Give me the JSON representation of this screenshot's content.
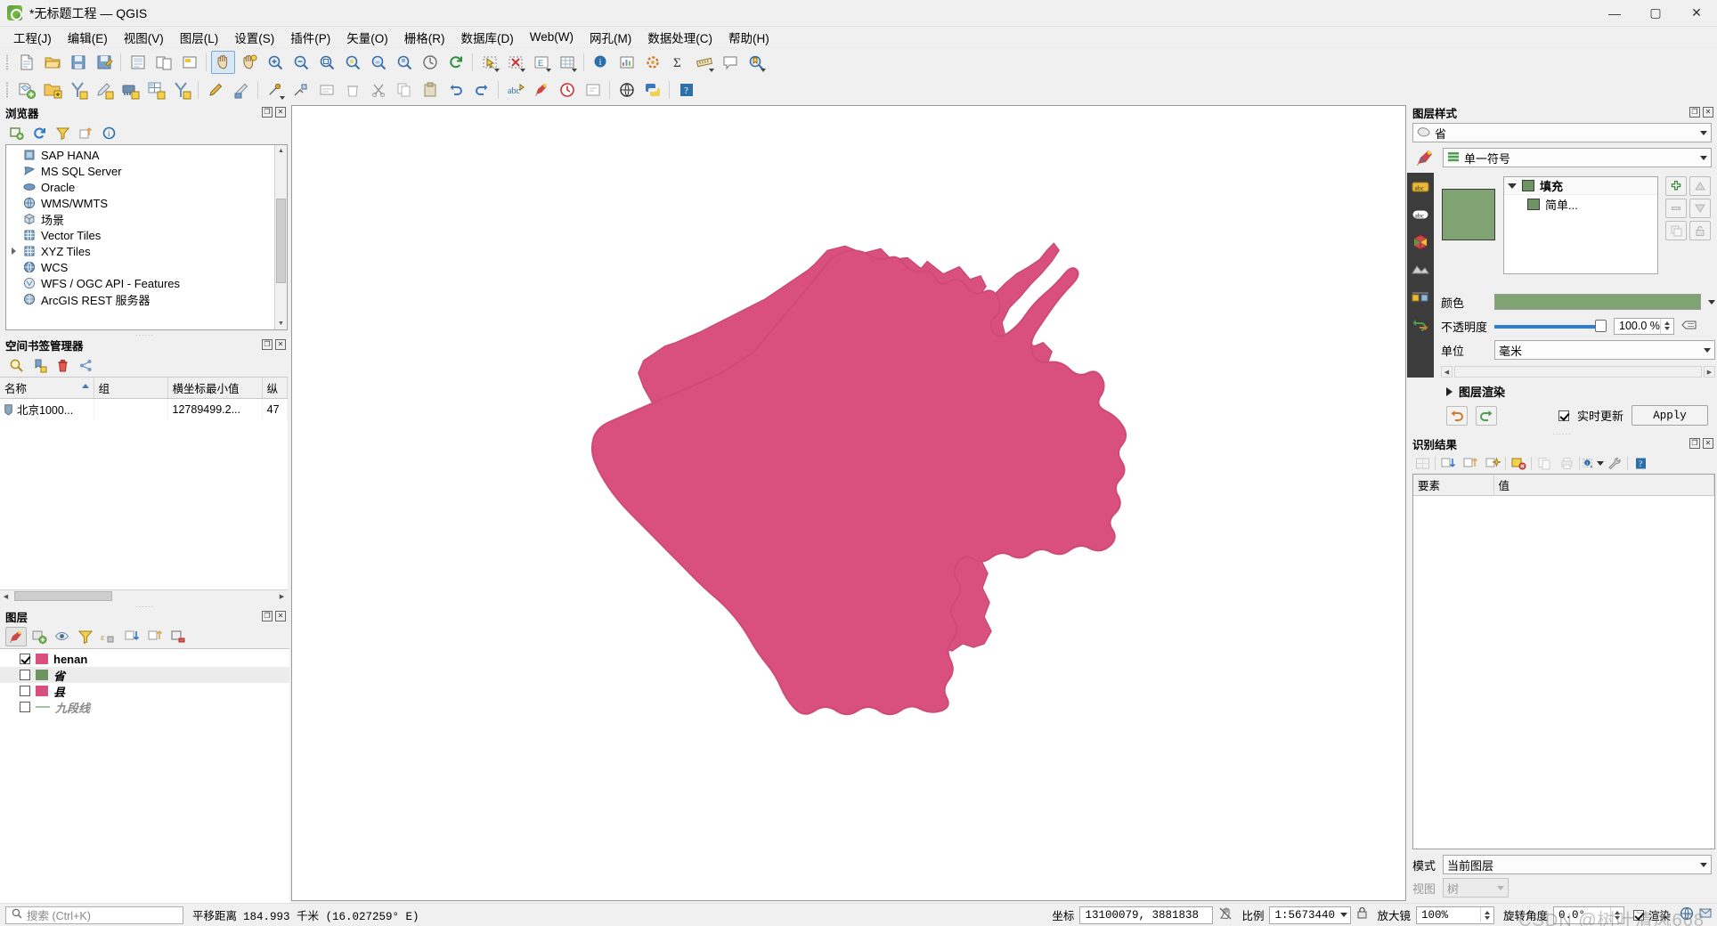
{
  "window": {
    "title": "*无标题工程 — QGIS",
    "app_icon": "qgis-logo-icon",
    "minimize": "—",
    "maximize": "▢",
    "close": "✕"
  },
  "menubar": {
    "items": [
      {
        "label": "工程(J)"
      },
      {
        "label": "编辑(E)"
      },
      {
        "label": "视图(V)"
      },
      {
        "label": "图层(L)"
      },
      {
        "label": "设置(S)"
      },
      {
        "label": "插件(P)"
      },
      {
        "label": "矢量(O)"
      },
      {
        "label": "栅格(R)"
      },
      {
        "label": "数据库(D)"
      },
      {
        "label": "Web(W)"
      },
      {
        "label": "网孔(M)"
      },
      {
        "label": "数据处理(C)"
      },
      {
        "label": "帮助(H)"
      }
    ]
  },
  "browser_panel": {
    "title": "浏览器",
    "tools": [
      "add-layer-icon",
      "refresh-icon",
      "filter-icon",
      "collapse-all-icon",
      "properties-info-icon"
    ],
    "items": [
      {
        "label": "SAP HANA",
        "icon": "sap-hana-icon",
        "expandable": false
      },
      {
        "label": "MS SQL Server",
        "icon": "mssql-icon",
        "expandable": false
      },
      {
        "label": "Oracle",
        "icon": "oracle-icon",
        "expandable": false
      },
      {
        "label": "WMS/WMTS",
        "icon": "wms-globe-icon",
        "expandable": false
      },
      {
        "label": "场景",
        "icon": "scene-cube-icon",
        "expandable": false
      },
      {
        "label": "Vector Tiles",
        "icon": "vector-tiles-icon",
        "expandable": false
      },
      {
        "label": "XYZ Tiles",
        "icon": "xyz-tiles-icon",
        "expandable": true
      },
      {
        "label": "WCS",
        "icon": "wcs-globe-icon",
        "expandable": false
      },
      {
        "label": "WFS / OGC API - Features",
        "icon": "wfs-icon",
        "expandable": false
      },
      {
        "label": "ArcGIS REST 服务器",
        "icon": "arcgis-rest-icon",
        "expandable": false
      }
    ]
  },
  "bookmarks_panel": {
    "title": "空间书签管理器",
    "tools": [
      "zoom-to-bookmark-icon",
      "add-bookmark-icon",
      "delete-bookmark-icon",
      "share-bookmark-icon"
    ],
    "columns": [
      "名称",
      "组",
      "横坐标最小值",
      "纵"
    ],
    "rows": [
      {
        "name": "北京1000...",
        "group": "",
        "xmin": "12789499.2...",
        "ymin": "47"
      }
    ]
  },
  "layers_panel": {
    "title": "图层",
    "tools": [
      "open-layer-styling-icon",
      "add-group-icon",
      "manage-visibility-icon",
      "filter-legend-icon",
      "expression-filter-icon",
      "expand-all-icon",
      "collapse-all-icon",
      "remove-layer-icon"
    ],
    "layers": [
      {
        "label": "henan",
        "checked": true,
        "symbol": "fill",
        "color": "#d9507e",
        "bold": true,
        "italic": false
      },
      {
        "label": "省",
        "checked": false,
        "symbol": "fill",
        "color": "#6f9463",
        "bold": false,
        "italic": true
      },
      {
        "label": "县",
        "checked": false,
        "symbol": "fill",
        "color": "#d9507e",
        "bold": false,
        "italic": true
      },
      {
        "label": "九段线",
        "checked": false,
        "symbol": "line",
        "color": "#9fc79f",
        "bold": false,
        "italic": true
      }
    ]
  },
  "map_canvas": {
    "name": "map-canvas",
    "feature_label": "henan-polygon",
    "fill_color": "#d9507e",
    "background": "#ffffff"
  },
  "layer_styling_panel": {
    "title": "图层样式",
    "layer_select": "省",
    "layer_select_icon": "polygon-layer-icon",
    "renderer": "单一符号",
    "renderer_icon": "single-symbol-icon",
    "side_tabs": [
      "labels-abc-icon",
      "masks-abc-icon",
      "3d-view-cube-icon",
      "diagrams-icon",
      "history-icon",
      "undo-redo-icon"
    ],
    "symbol_tree": [
      {
        "label": "填充",
        "indent": 0,
        "color": "#6f9463",
        "expanded": true
      },
      {
        "label": "简单...",
        "indent": 1,
        "color": "#6f9463",
        "expanded": false
      }
    ],
    "preview_color": "#7fa373",
    "side_buttons": [
      "add-symbol-layer-icon",
      "move-up-icon",
      "remove-symbol-layer-icon",
      "move-down-icon",
      "duplicate-icon",
      "lock-icon"
    ],
    "fields": {
      "color_label": "颜色",
      "color_value": "#7fa373",
      "opacity_label": "不透明度",
      "opacity_value": "100.0 %",
      "unit_label": "单位",
      "unit_value": "毫米"
    },
    "layer_rendering_label": "图层渲染",
    "undo_icon": "undo-arrow-icon",
    "redo_icon": "redo-arrow-icon",
    "live_update_label": "实时更新",
    "live_update_checked": true,
    "apply_label": "Apply"
  },
  "identify_panel": {
    "title": "识别结果",
    "tools": [
      "expand-tree-icon",
      "expand-all-icon",
      "collapse-all-icon",
      "highlight-icon",
      "clear-results-icon",
      "copy-icon",
      "print-icon",
      "identify-mode-icon",
      "settings-wrench-icon",
      "help-icon"
    ],
    "columns": [
      "要素",
      "值"
    ],
    "rows": [],
    "mode_label": "模式",
    "mode_value": "当前图层",
    "view_label": "视图",
    "view_value": "树"
  },
  "statusbar": {
    "search_placeholder": "搜索 (Ctrl+K)",
    "search_icon": "search-icon",
    "pan_label": "平移距离",
    "pan_value": "184.993 千米 (16.027259° E)",
    "coord_label": "坐标",
    "coord_value": "13100079, 3881838",
    "coord_lock_icon": "coordinate-capture-icon",
    "scale_label": "比例",
    "scale_value": "1:5673440",
    "lock_icon": "lock-scale-icon",
    "magnifier_label": "放大镜",
    "magnifier_value": "100%",
    "rotation_label": "旋转角度",
    "rotation_value": "0.0°",
    "render_label": "渲染",
    "render_checked": true,
    "crs_icon": "crs-icon",
    "messages_icon": "messages-icon",
    "watermark": "CSDN @树叶清风668"
  },
  "colors": {
    "accent_pink": "#d9507e",
    "accent_green": "#6f9463",
    "panel_bg": "#f0f0f0",
    "canvas_bg": "#ffffff",
    "slider_blue": "#2e7fd0"
  }
}
